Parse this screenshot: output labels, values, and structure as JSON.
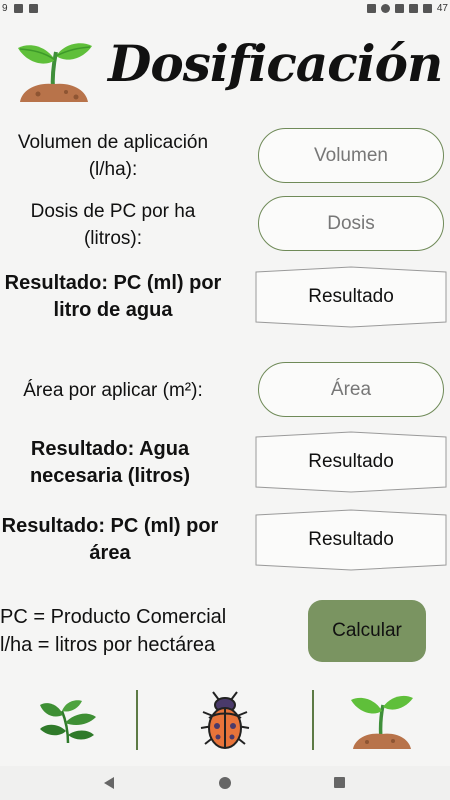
{
  "status_bar": {
    "time": "9",
    "battery": "47"
  },
  "header": {
    "title": "Dosificación"
  },
  "form": {
    "volumen_label": "Volumen de aplicación (l/ha):",
    "volumen_placeholder": "Volumen",
    "dosis_label": "Dosis de PC por ha (litros):",
    "dosis_placeholder": "Dosis",
    "resultado_pc_label": "Resultado: PC (ml) por litro de agua",
    "resultado_pc_value": "Resultado",
    "area_label": "Área por aplicar (m²):",
    "area_placeholder": "Área",
    "resultado_agua_label": "Resultado: Agua necesaria (litros)",
    "resultado_agua_value": "Resultado",
    "resultado_pc_area_label": "Resultado: PC (ml) por área",
    "resultado_pc_area_value": "Resultado"
  },
  "legend": {
    "line1": "PC = Producto Comercial",
    "line2": "l/ha = litros por hectárea"
  },
  "calc_button": "Calcular",
  "bottom_nav": {
    "items": [
      "plant-leaves-icon",
      "ladybug-icon",
      "sprout-icon"
    ]
  },
  "colors": {
    "accent": "#7a9461",
    "border": "#6f8a58",
    "background": "#f5f5f4"
  }
}
